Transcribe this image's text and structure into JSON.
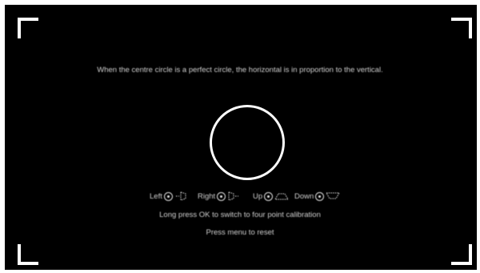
{
  "calibration": {
    "instruction": "When the centre circle is a perfect circle, the horizontal is in proportion to the vertical.",
    "directions": [
      {
        "label": "Left",
        "icon": "keystone-left-icon"
      },
      {
        "label": "Right",
        "icon": "keystone-right-icon"
      },
      {
        "label": "Up",
        "icon": "keystone-up-icon"
      },
      {
        "label": "Down",
        "icon": "keystone-down-icon"
      }
    ],
    "four_point_hint": "Long press OK to switch to four point calibration",
    "reset_hint": "Press menu to reset"
  },
  "colors": {
    "background": "#000000",
    "foreground": "#ffffff",
    "text": "#cfcfcf"
  }
}
